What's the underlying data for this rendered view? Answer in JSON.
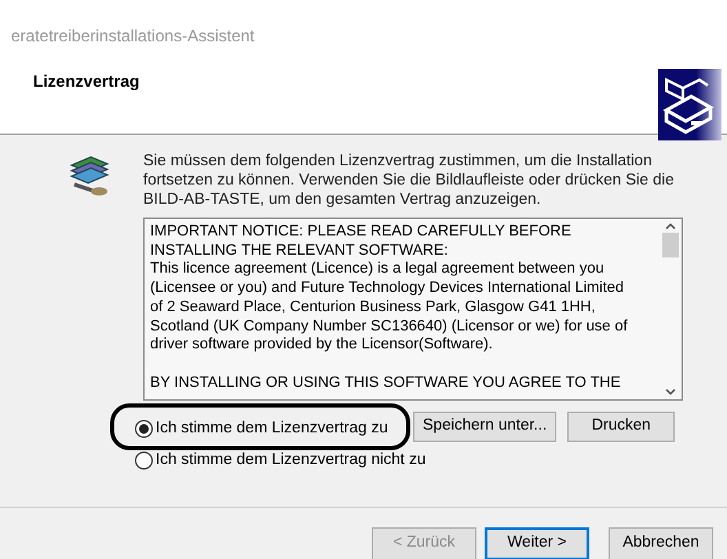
{
  "window": {
    "title": "eratetreiberinstallations-Assistent"
  },
  "header": {
    "title": "Lizenzvertrag"
  },
  "intro": "Sie müssen dem folgenden Lizenzvertrag zustimmen, um die Installation fortsetzen zu können. Verwenden Sie die Bildlaufleiste oder drücken Sie die BILD-AB-TASTE, um den gesamten Vertrag anzuzeigen.",
  "license_paragraphs": [
    {
      "lines": [
        "IMPORTANT NOTICE: PLEASE READ CAREFULLY BEFORE",
        "INSTALLING THE RELEVANT SOFTWARE:",
        "This licence agreement (Licence) is a legal agreement between you",
        "(Licensee or you) and Future Technology Devices International Limited",
        "of 2 Seaward Place, Centurion Business Park, Glasgow G41 1HH,",
        "Scotland (UK Company Number SC136640) (Licensor or we) for use of",
        "driver software provided by the Licensor(Software)."
      ]
    },
    {
      "lines": [
        "BY INSTALLING OR USING THIS SOFTWARE YOU AGREE TO THE"
      ]
    }
  ],
  "options": [
    {
      "label": "Ich stimme dem Lizenzvertrag zu",
      "selected": true,
      "circled": true
    },
    {
      "label": "Ich stimme dem Lizenzvertrag nicht zu",
      "selected": false,
      "circled": false
    }
  ],
  "side_buttons": [
    "Speichern unter...",
    "Drucken"
  ],
  "nav_buttons": [
    {
      "label": "< Zurück",
      "disabled": true,
      "default": false
    },
    {
      "label": "Weiter >",
      "disabled": false,
      "default": true
    },
    {
      "label": "Abbrechen",
      "disabled": false,
      "default": false
    }
  ]
}
